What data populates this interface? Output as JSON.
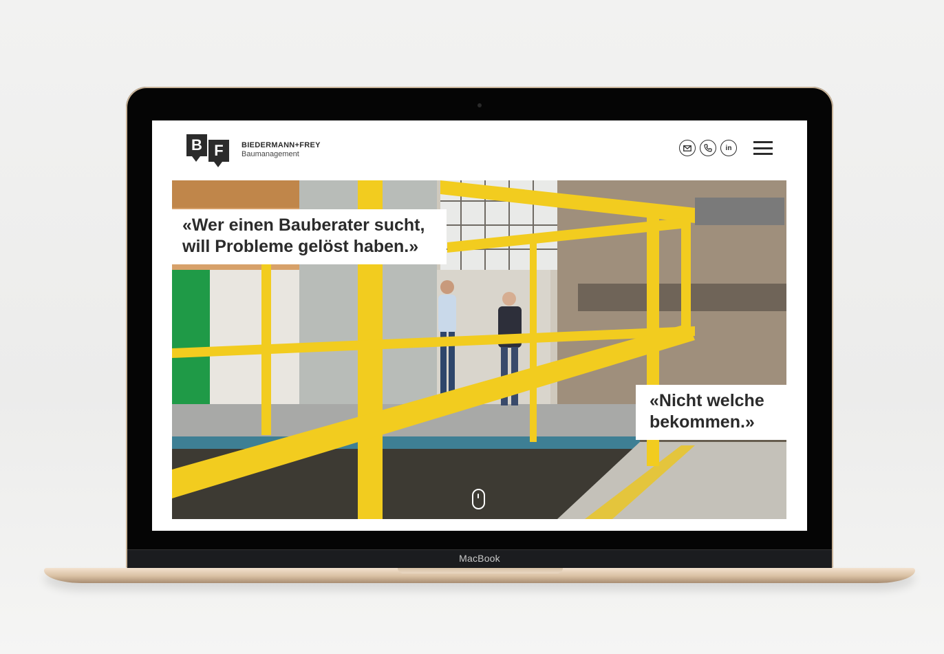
{
  "device": {
    "brand_label": "MacBook"
  },
  "header": {
    "logo": {
      "mark_left": "B",
      "mark_right": "F",
      "name": "BIEDERMANN+FREY",
      "subtitle": "Baumanagement"
    },
    "icons": [
      "mail-icon",
      "phone-icon",
      "linkedin-icon",
      "menu-icon"
    ],
    "linkedin_glyph": "in"
  },
  "hero": {
    "quote_1": "«Wer einen Bauberater sucht, will Probleme gelöst haben.»",
    "quote_2": "«Nicht welche bekommen.»",
    "scroll_indicator": "scroll-mouse-icon"
  },
  "colors": {
    "accent_yellow": "#f2cc1f",
    "text_dark": "#2b2b2b",
    "lid": "#050505",
    "gold": "#d8bfa2"
  }
}
